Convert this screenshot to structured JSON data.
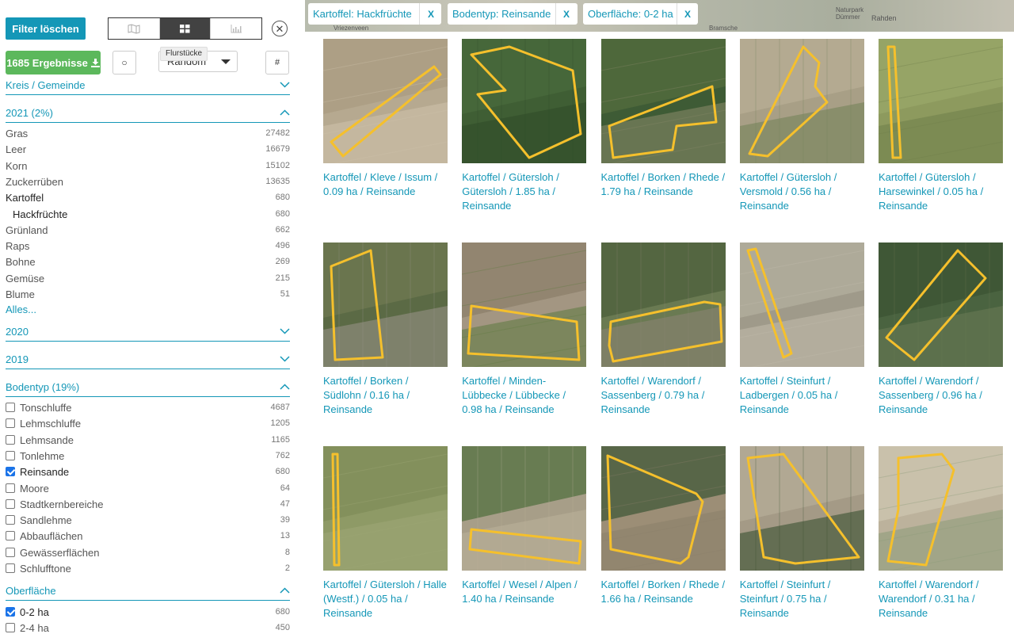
{
  "toolbar": {
    "clear_filter_label": "Filter löschen",
    "view_modes": [
      {
        "icon": "map-icon",
        "active": false
      },
      {
        "icon": "grid-icon",
        "active": true
      },
      {
        "icon": "chart-icon",
        "active": false
      }
    ],
    "close_symbol": "✕",
    "results_label": "1685 Ergebnisse",
    "circle_label": "○",
    "sort_value": "Random",
    "tooltip": "Flurstücke",
    "hash_label": "#"
  },
  "sections": {
    "kreis": "Kreis / Gemeinde",
    "year2021": "2021 (2%)",
    "year2020": "2020",
    "year2019": "2019",
    "bodentyp": "Bodentyp (19%)",
    "oberflaeche": "Oberfläche"
  },
  "crops": [
    {
      "label": "Gras",
      "count": "27482"
    },
    {
      "label": "Leer",
      "count": "16679"
    },
    {
      "label": "Korn",
      "count": "15102"
    },
    {
      "label": "Zuckerrüben",
      "count": "13635"
    },
    {
      "label": "Kartoffel",
      "count": "680"
    },
    {
      "label": "Hackfrüchte",
      "count": "680"
    },
    {
      "label": "Grünland",
      "count": "662"
    },
    {
      "label": "Raps",
      "count": "496"
    },
    {
      "label": "Bohne",
      "count": "269"
    },
    {
      "label": "Gemüse",
      "count": "215"
    },
    {
      "label": "Blume",
      "count": "51"
    }
  ],
  "more_label": "Alles...",
  "soils": [
    {
      "label": "Tonschluffe",
      "count": "4687",
      "checked": false
    },
    {
      "label": "Lehmschluffe",
      "count": "1205",
      "checked": false
    },
    {
      "label": "Lehmsande",
      "count": "1165",
      "checked": false
    },
    {
      "label": "Tonlehme",
      "count": "762",
      "checked": false
    },
    {
      "label": "Reinsande",
      "count": "680",
      "checked": true
    },
    {
      "label": "Moore",
      "count": "64",
      "checked": false
    },
    {
      "label": "Stadtkernbereiche",
      "count": "47",
      "checked": false
    },
    {
      "label": "Sandlehme",
      "count": "39",
      "checked": false
    },
    {
      "label": "Abbauflächen",
      "count": "13",
      "checked": false
    },
    {
      "label": "Gewässerflächen",
      "count": "8",
      "checked": false
    },
    {
      "label": "Schlufftone",
      "count": "2",
      "checked": false
    }
  ],
  "areas": [
    {
      "label": "0-2 ha",
      "count": "680",
      "checked": true
    },
    {
      "label": "2-4 ha",
      "count": "450",
      "checked": false
    }
  ],
  "map_labels": [
    "Vriezenveen",
    "Bramsche",
    "Naturpark Dümmer",
    "Rahden"
  ],
  "chips": [
    {
      "label": "Kartoffel: Hackfrüchte",
      "remove": "X"
    },
    {
      "label": "Bodentyp: Reinsande",
      "remove": "X"
    },
    {
      "label": "Oberfläche: 0-2 ha",
      "remove": "X"
    }
  ],
  "parcels": [
    {
      "caption": "Kartoffel / Kleve / Issum / 0.09 ha / Reinsande"
    },
    {
      "caption": "Kartoffel / Gütersloh / Gütersloh / 1.85 ha / Reinsande"
    },
    {
      "caption": "Kartoffel / Borken / Rhede / 1.79 ha / Reinsande"
    },
    {
      "caption": "Kartoffel / Gütersloh / Versmold / 0.56 ha / Reinsande"
    },
    {
      "caption": "Kartoffel / Gütersloh / Harsewinkel / 0.05 ha / Reinsande"
    },
    {
      "caption": "Kartoffel / Borken / Südlohn / 0.16 ha / Reinsande"
    },
    {
      "caption": "Kartoffel / Minden-Lübbecke / Lübbecke / 0.98 ha / Reinsande"
    },
    {
      "caption": "Kartoffel / Warendorf / Sassenberg / 0.79 ha / Reinsande"
    },
    {
      "caption": "Kartoffel / Steinfurt / Ladbergen / 0.05 ha / Reinsande"
    },
    {
      "caption": "Kartoffel / Warendorf / Sassenberg / 0.96 ha / Reinsande"
    },
    {
      "caption": "Kartoffel / Gütersloh / Halle (Westf.) / 0.05 ha / Reinsande"
    },
    {
      "caption": "Kartoffel / Wesel / Alpen / 1.40 ha / Reinsande"
    },
    {
      "caption": "Kartoffel / Borken / Rhede / 1.66 ha / Reinsande"
    },
    {
      "caption": "Kartoffel / Steinfurt / Steinfurt / 0.75 ha / Reinsande"
    },
    {
      "caption": "Kartoffel / Warendorf / Warendorf / 0.31 ha / Reinsande"
    }
  ],
  "colors": {
    "accent": "#1497b7",
    "success": "#5cb85c",
    "outline": "#f5c02c"
  }
}
